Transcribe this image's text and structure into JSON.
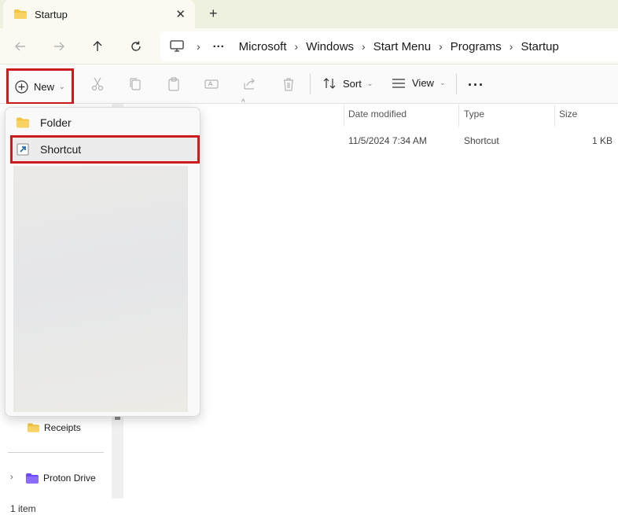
{
  "window": {
    "tab_title": "Startup",
    "close_glyph": "✕",
    "newtab_glyph": "+"
  },
  "nav": {
    "overflow_glyph": "···",
    "sep": "›",
    "breadcrumbs": [
      "Microsoft",
      "Windows",
      "Start Menu",
      "Programs",
      "Startup"
    ]
  },
  "toolbar": {
    "new_label": "New",
    "sort_label": "Sort",
    "view_label": "View",
    "chevron": "⌄",
    "more_glyph": "···"
  },
  "columns": {
    "date_modified": "Date modified",
    "type": "Type",
    "size": "Size",
    "sort_caret": "^"
  },
  "file_row": {
    "date": "11/5/2024 7:34 AM",
    "type": "Shortcut",
    "size": "1 KB"
  },
  "new_menu": {
    "items": [
      {
        "label": "Folder",
        "icon": "folder-icon"
      },
      {
        "label": "Shortcut",
        "icon": "shortcut-icon"
      }
    ]
  },
  "sidebar": {
    "items": [
      {
        "label": "Receipts",
        "icon": "folder-icon"
      },
      {
        "label": "Proton Drive",
        "icon": "proton-drive-icon"
      }
    ],
    "expand_glyph": "›"
  },
  "status": {
    "item_count": "1 item"
  },
  "colors": {
    "highlight_border": "#cc1b1b",
    "folder_yellow": "#f4c542",
    "proton_purple": "#6d4aff",
    "titlebar_bg": "#eef0e0"
  }
}
